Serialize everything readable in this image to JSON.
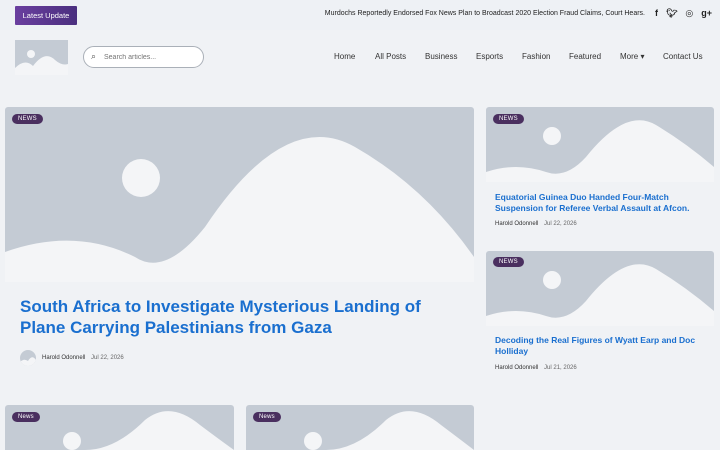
{
  "topbar": {
    "latest_label": "Latest Update",
    "ticker": "Murdochs Reportedly Endorsed Fox News Plan to Broadcast 2020 Election Fraud Claims, Court Hears.",
    "social": [
      "f",
      "t",
      "ig",
      "g+"
    ]
  },
  "header": {
    "search_placeholder": "Search articles...",
    "nav": [
      "Home",
      "All Posts",
      "Business",
      "Esports",
      "Fashion",
      "Featured",
      "More ▾",
      "Contact Us"
    ]
  },
  "feature": {
    "badge": "NEWS",
    "title": "South Africa to Investigate Mysterious Landing of Plane Carrying Palestinians from Gaza",
    "author": "Harold Odonnell",
    "date": "Jul 22, 2026"
  },
  "side_posts": [
    {
      "badge": "NEWS",
      "title": "Equatorial Guinea Duo Handed Four-Match Suspension for Referee Verbal Assault at Afcon.",
      "author": "Harold Odonnell",
      "date": "Jul 22, 2026"
    },
    {
      "badge": "NEWS",
      "title": "Decoding the Real Figures of Wyatt Earp and Doc Holliday",
      "author": "Harold Odonnell",
      "date": "Jul 21, 2026"
    }
  ],
  "bottom_posts": [
    {
      "badge": "News"
    },
    {
      "badge": "News"
    }
  ],
  "colors": {
    "accent": "#1a6fcf",
    "badge": "#4a2f5f",
    "placeholder": "#c4cbd4"
  }
}
